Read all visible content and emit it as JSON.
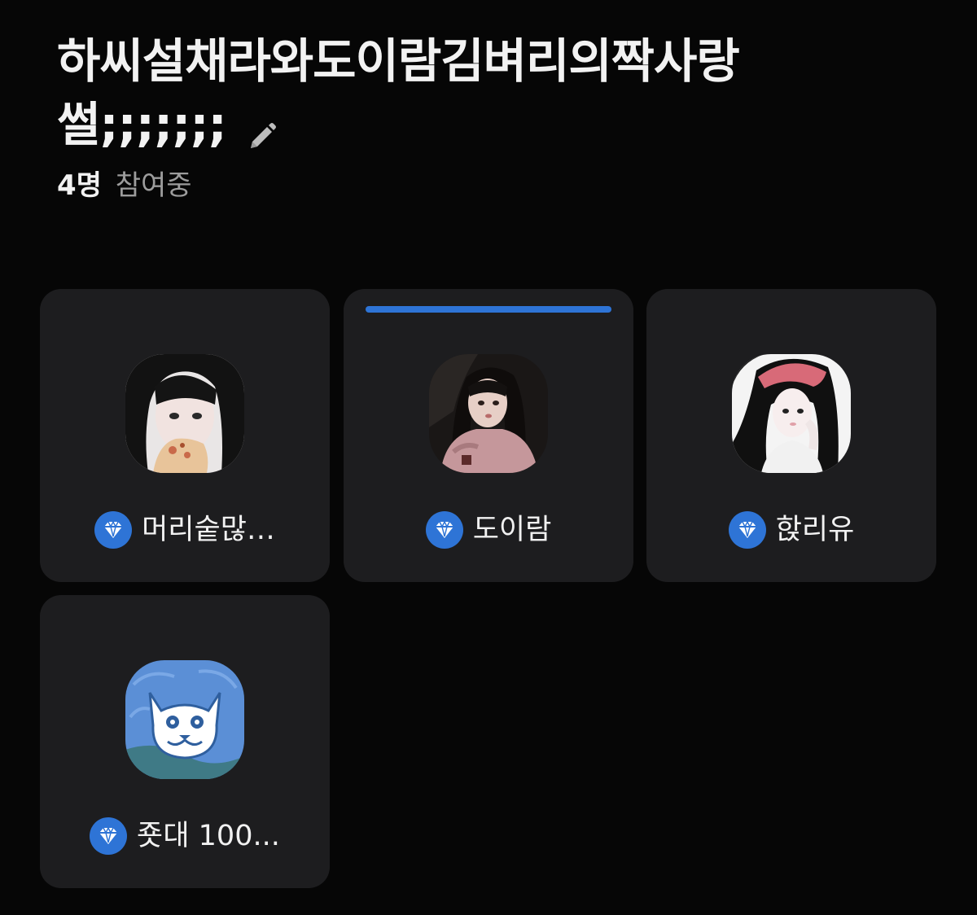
{
  "room": {
    "title_line1": "하씨설채라와도이람김벼리의짝사랑",
    "title_line2": "썰;;;;;;;",
    "participant_count": "4명",
    "participant_label": "참여중"
  },
  "participants": [
    {
      "name": "머리숱많…",
      "badge_icon": "diamond-badge-icon",
      "speaking": false
    },
    {
      "name": "도이람",
      "badge_icon": "diamond-badge-icon",
      "speaking": true
    },
    {
      "name": "핝리유",
      "badge_icon": "diamond-badge-icon",
      "speaking": false
    },
    {
      "name": "죳대 100...",
      "badge_icon": "diamond-badge-icon",
      "speaking": false
    }
  ],
  "colors": {
    "background": "#060606",
    "card": "#1d1d1f",
    "accent": "#2e74d6",
    "muted_text": "#9c9c9c"
  }
}
